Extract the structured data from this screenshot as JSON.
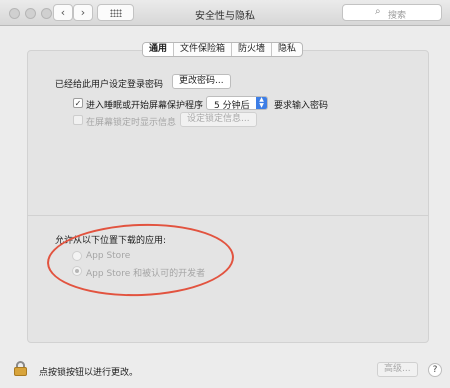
{
  "window": {
    "title": "安全性与隐私"
  },
  "toolbar": {
    "back_icon": "chevron-left-icon",
    "forward_icon": "chevron-right-icon",
    "grid_icon": "grid-icon",
    "search_placeholder": "搜索"
  },
  "tabs": [
    {
      "label": "通用",
      "active": true
    },
    {
      "label": "文件保险箱",
      "active": false
    },
    {
      "label": "防火墙",
      "active": false
    },
    {
      "label": "隐私",
      "active": false
    }
  ],
  "general": {
    "password_set_label": "已经给此用户设定登录密码",
    "change_password_button": "更改密码...",
    "require_password_checkbox_label": "进入睡眠或开始屏幕保护程序",
    "require_password_checked": true,
    "require_password_delay": "5 分钟后",
    "require_password_suffix": "要求输入密码",
    "lock_message_checkbox_label": "在屏幕锁定时显示信息",
    "lock_message_checked": false,
    "set_lock_message_button": "设定锁定信息..."
  },
  "downloads": {
    "heading": "允许从以下位置下载的应用:",
    "options": [
      {
        "label": "App Store",
        "selected": false
      },
      {
        "label": "App Store 和被认可的开发者",
        "selected": true
      }
    ]
  },
  "footer": {
    "lock_label": "点按锁按钮以进行更改。",
    "advanced_button": "高级...",
    "help_button": "?"
  },
  "colors": {
    "annotation_ellipse": "#e2533f",
    "accent": "#3d7ee6"
  }
}
